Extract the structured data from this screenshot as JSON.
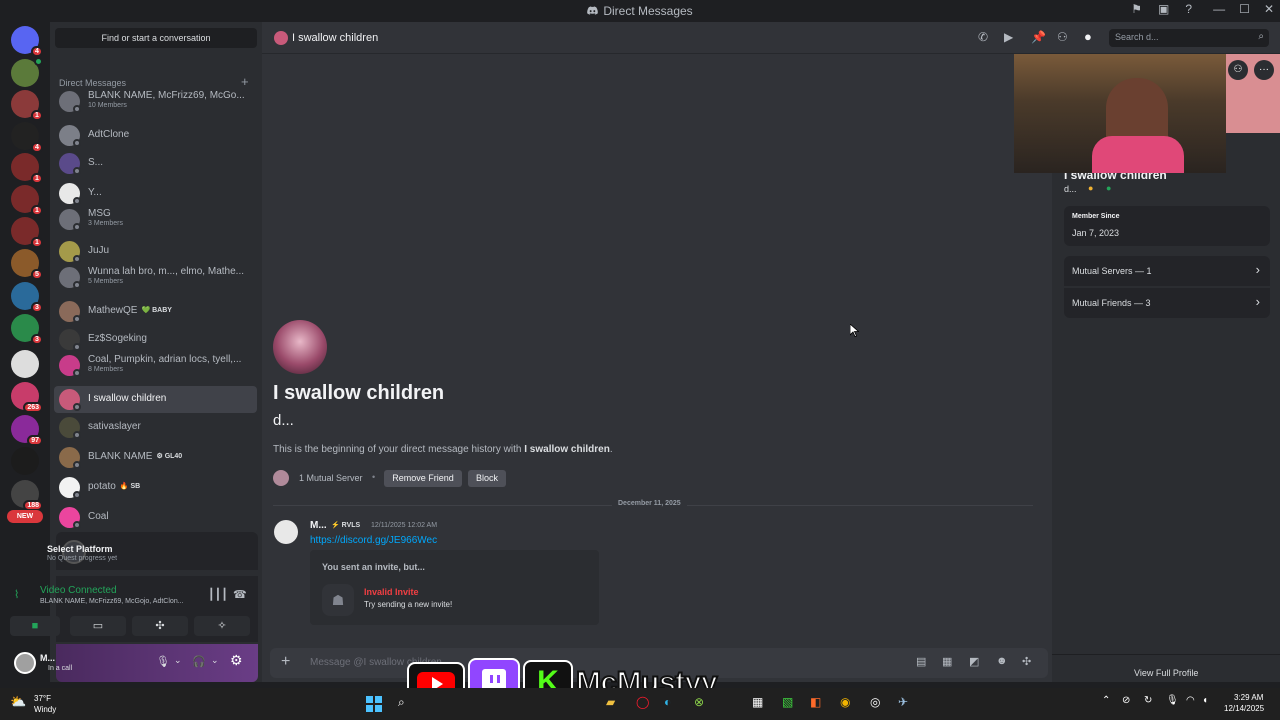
{
  "window": {
    "title": "Direct Messages"
  },
  "rail": {
    "servers": [
      {
        "color": "#5865f2",
        "badge": "4"
      },
      {
        "color": "#5b7a3a",
        "badge": "",
        "online": true
      },
      {
        "color": "#8b3a3a",
        "badge": "1"
      },
      {
        "color": "#222222",
        "badge": "4"
      },
      {
        "color": "#7a2a2a",
        "badge": "1"
      },
      {
        "color": "#7a2a2a",
        "badge": "1"
      },
      {
        "color": "#7a2a2a",
        "badge": "1"
      },
      {
        "color": "#8b5a2a",
        "badge": "5"
      },
      {
        "color": "#2a6a9a",
        "badge": "3"
      },
      {
        "color": "#2a8a4a",
        "badge": "3"
      },
      {
        "color": "#dddddd",
        "badge": ""
      },
      {
        "color": "#c83c6a",
        "badge": "263"
      },
      {
        "color": "#8a2a9a",
        "badge": "97"
      },
      {
        "color": "#1c1c1c",
        "badge": ""
      },
      {
        "color": "#444444",
        "badge": "188"
      }
    ],
    "new_label": "NEW"
  },
  "dm_sidebar": {
    "find_label": "Find or start a conversation",
    "heading": "Direct Messages",
    "items": [
      {
        "name": "BLANK NAME, McFrizz69, McGo...",
        "sub": "10 Members",
        "color": "#6d6f78"
      },
      {
        "name": "AdtClone",
        "sub": "",
        "color": "#7c7f88"
      },
      {
        "name": "S...",
        "sub": "",
        "color": "#5a4a8a"
      },
      {
        "name": "Y...",
        "sub": "",
        "color": "#e8e8e8"
      },
      {
        "name": "MSG",
        "sub": "3 Members",
        "color": "#6d6f78"
      },
      {
        "name": "JuJu",
        "sub": "",
        "color": "#a49a4a"
      },
      {
        "name": "Wunna lah bro, m..., elmo, Mathe...",
        "sub": "5 Members",
        "color": "#6d6f78"
      },
      {
        "name": "MathewQE",
        "sub": "",
        "tag": "💚 BABY",
        "color": "#8a6a5a"
      },
      {
        "name": "Ez$Sogeking",
        "sub": "",
        "color": "#3a3a3a"
      },
      {
        "name": "Coal, Pumpkin, adrian locs, tyell,...",
        "sub": "8 Members",
        "color": "#c83c8a"
      },
      {
        "name": "I swallow children",
        "sub": "",
        "color": "#c85a7a",
        "active": true
      },
      {
        "name": "sativaslayer",
        "sub": "",
        "color": "#4a4a3a"
      },
      {
        "name": "BLANK NAME",
        "sub": "",
        "tag": "⚙ GL40",
        "color": "#8a6a4a"
      },
      {
        "name": "potato",
        "sub": "",
        "tag": "🔥 SB",
        "color": "#f2f2f2"
      },
      {
        "name": "Coal",
        "sub": "",
        "color": "#eb459e"
      }
    ]
  },
  "quest": {
    "title": "Select Platform",
    "sub": "No Quest progress yet"
  },
  "voice": {
    "status": "Video Connected",
    "channel": "BLANK NAME, McFrizz69, McGojo, AdtClon..."
  },
  "user": {
    "name": "M...",
    "status": "In a call"
  },
  "chat_header": {
    "name": "I swallow children",
    "search_placeholder": "Search d..."
  },
  "intro": {
    "name": "I swallow children",
    "username": "d...",
    "text_prefix": "This is the beginning of your direct message history with ",
    "text_name": "I swallow children",
    "text_suffix": ".",
    "mutual_server": "1 Mutual Server",
    "remove_friend": "Remove Friend",
    "block": "Block"
  },
  "divider_date": "December 11, 2025",
  "message": {
    "author": "M...",
    "tag": "⚡ RVLS",
    "timestamp": "12/11/2025 12:02 AM",
    "link": "https://discord.gg/JE966Wec",
    "invite_heading": "You sent an invite, but...",
    "invite_title": "Invalid Invite",
    "invite_sub": "Try sending a new invite!"
  },
  "composer": {
    "placeholder": "Message @I swallow children"
  },
  "profile": {
    "name": "I swallow children",
    "username": "d...",
    "member_since_label": "Member Since",
    "member_since": "Jan 7, 2023",
    "mutual_servers": "Mutual Servers — 1",
    "mutual_friends": "Mutual Friends — 3",
    "view_full": "View Full Profile"
  },
  "overlay": {
    "brand_text": "McMustyy"
  },
  "taskbar": {
    "temp": "37°F",
    "weather": "Windy",
    "time": "3:29 AM",
    "date": "12/14/2025"
  }
}
